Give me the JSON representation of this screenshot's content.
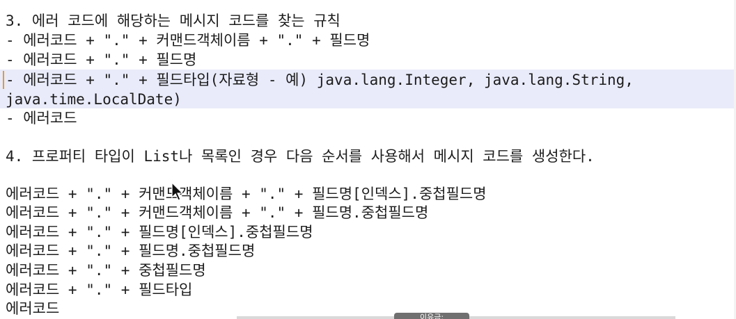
{
  "editor": {
    "lines": [
      "3. 에러 코드에 해당하는 메시지 코드를 찾는 규칙",
      "- 에러코드 + \".\" + 커맨드객체이름 + \".\" + 필드명",
      "- 에러코드 + \".\" + 필드명",
      "- 에러코드 + \".\" + 필드타입(자료형 - 예) java.lang.Integer, java.lang.String,",
      "java.time.LocalDate)",
      "- 에러코드",
      "",
      "4. 프로퍼티 타입이 List나 목록인 경우 다음 순서를 사용해서 메시지 코드를 생성한다.",
      "",
      "에러코드 + \".\" + 커맨드객체이름 + \".\" + 필드명[인덱스].중첩필드명",
      "에러코드 + \".\" + 커맨드객체이름 + \".\" + 필드명.중첩필드명",
      "에러코드 + \".\" + 필드명[인덱스].중첩필드명",
      "에러코드 + \".\" + 필드명.중첩필드명",
      "에러코드 + \".\" + 중첩필드명",
      "에러코드 + \".\" + 필드타입",
      "에러코드"
    ],
    "highlight_color": "#e9ebfa",
    "text_color": "#1c1c1c"
  },
  "overlay": {
    "tooltip_text": "이유금:",
    "cursor_icon": "mouse-pointer-icon"
  }
}
